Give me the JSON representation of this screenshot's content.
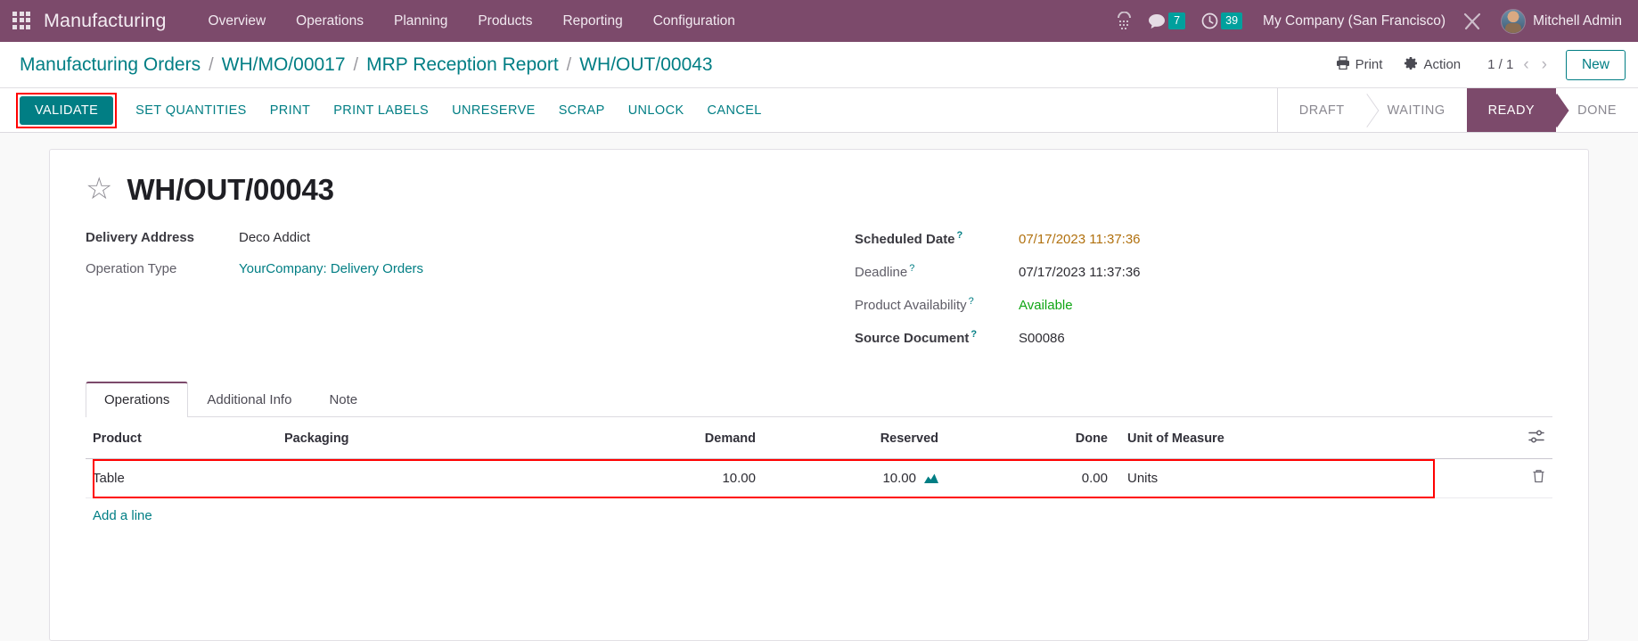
{
  "navbar": {
    "apps_icon": "apps-grid-icon",
    "brand": "Manufacturing",
    "menu": [
      {
        "label": "Overview"
      },
      {
        "label": "Operations"
      },
      {
        "label": "Planning"
      },
      {
        "label": "Products"
      },
      {
        "label": "Reporting"
      },
      {
        "label": "Configuration"
      }
    ],
    "icons": {
      "barcode": "barcode-icon",
      "messages": "chat-bubble-icon",
      "activities": "clock-icon",
      "tools": "wrench-icon"
    },
    "messages_count": "7",
    "activities_count": "39",
    "company": "My Company (San Francisco)",
    "user": "Mitchell Admin"
  },
  "controlpanel": {
    "breadcrumb": [
      {
        "label": "Manufacturing Orders"
      },
      {
        "label": "WH/MO/00017"
      },
      {
        "label": "MRP Reception Report"
      },
      {
        "label": "WH/OUT/00043"
      }
    ],
    "separator": "/",
    "print_label": "Print",
    "action_label": "Action",
    "pager": "1 / 1",
    "prev_arrow": "‹",
    "next_arrow": "›",
    "new_label": "New"
  },
  "statusbar": {
    "buttons": [
      {
        "label": "VALIDATE",
        "primary": true,
        "highlighted": true
      },
      {
        "label": "SET QUANTITIES",
        "primary": false
      },
      {
        "label": "PRINT",
        "primary": false
      },
      {
        "label": "PRINT LABELS",
        "primary": false
      },
      {
        "label": "UNRESERVE",
        "primary": false
      },
      {
        "label": "SCRAP",
        "primary": false
      },
      {
        "label": "UNLOCK",
        "primary": false
      },
      {
        "label": "CANCEL",
        "primary": false
      }
    ],
    "states": [
      {
        "label": "DRAFT",
        "active": false
      },
      {
        "label": "WAITING",
        "active": false
      },
      {
        "label": "READY",
        "active": true
      },
      {
        "label": "DONE",
        "active": false
      }
    ]
  },
  "record": {
    "star_icon": "star-icon",
    "title": "WH/OUT/00043",
    "left_fields": [
      {
        "label": "Delivery Address",
        "value": "Deco Addict",
        "bold_label": true,
        "style": "plain",
        "help": false
      },
      {
        "label": "Operation Type",
        "value": "YourCompany: Delivery Orders",
        "bold_label": false,
        "style": "link",
        "help": false
      }
    ],
    "right_fields": [
      {
        "label": "Scheduled Date",
        "value": "07/17/2023 11:37:36",
        "bold_label": true,
        "style": "warn",
        "help": true
      },
      {
        "label": "Deadline",
        "value": "07/17/2023 11:37:36",
        "bold_label": false,
        "style": "plain",
        "help": true
      },
      {
        "label": "Product Availability",
        "value": "Available",
        "bold_label": false,
        "style": "ok",
        "help": true
      },
      {
        "label": "Source Document",
        "value": "S00086",
        "bold_label": true,
        "style": "plain",
        "help": true
      }
    ],
    "help_marker": "?"
  },
  "notebook": {
    "tabs": [
      {
        "label": "Operations",
        "active": true
      },
      {
        "label": "Additional Info",
        "active": false
      },
      {
        "label": "Note",
        "active": false
      }
    ]
  },
  "lines_table": {
    "columns": [
      {
        "label": "Product",
        "align": "left"
      },
      {
        "label": "Packaging",
        "align": "left"
      },
      {
        "label": "Demand",
        "align": "right"
      },
      {
        "label": "Reserved",
        "align": "right"
      },
      {
        "label": "Done",
        "align": "right"
      },
      {
        "label": "Unit of Measure",
        "align": "left"
      }
    ],
    "optional_columns_icon": "column-settings-icon",
    "rows": [
      {
        "product": "Table",
        "packaging": "",
        "demand": "10.00",
        "reserved": "10.00",
        "reserved_icon": "forecast-chart-icon",
        "done": "0.00",
        "uom": "Units",
        "delete_icon": "trash-icon",
        "highlighted": true
      }
    ],
    "add_line_label": "Add a line"
  },
  "colors": {
    "brand_purple": "#7c4a6b",
    "accent_teal": "#017e84",
    "badge_teal": "#00a09d",
    "warn_orange": "#b1710f",
    "success_green": "#11a616",
    "highlight_red": "#ff0000"
  }
}
